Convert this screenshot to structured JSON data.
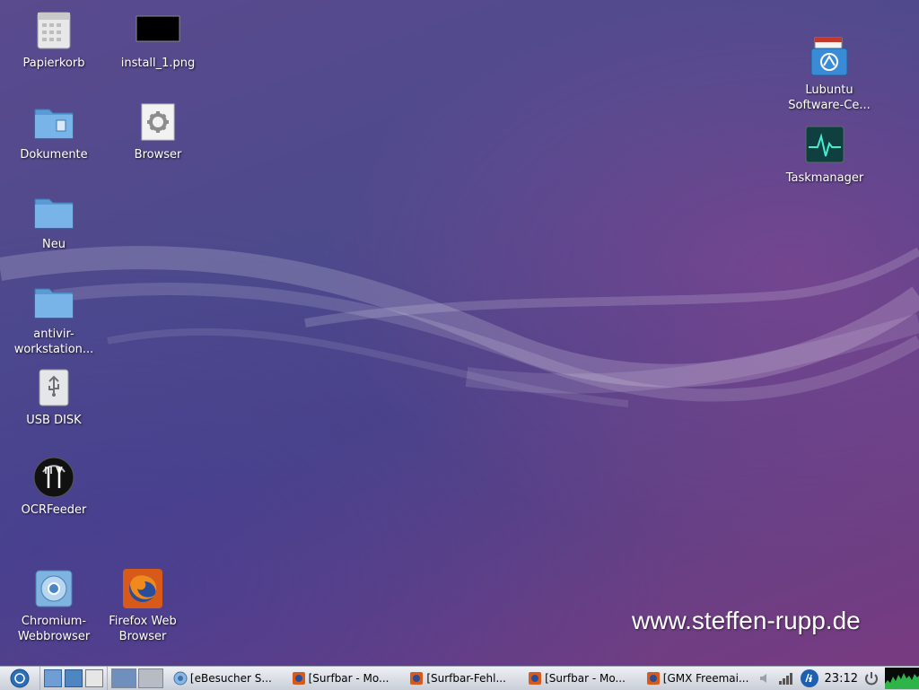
{
  "desktop": {
    "icons_left": [
      {
        "label": "Papierkorb"
      },
      {
        "label": "Dokumente"
      },
      {
        "label": "Neu"
      },
      {
        "label": "antivir-\nworkstation..."
      },
      {
        "label": "USB DISK"
      },
      {
        "label": "OCRFeeder"
      },
      {
        "label": "Chromium-\nWebbrowser"
      }
    ],
    "icons_second": [
      {
        "label": "install_1.png"
      },
      {
        "label": "Browser"
      },
      {
        "label": "Firefox Web\nBrowser"
      }
    ],
    "icons_right": [
      {
        "label": "Lubuntu\nSoftware-Ce..."
      },
      {
        "label": "Taskmanager"
      }
    ],
    "watermark": "www.steffen-rupp.de"
  },
  "taskbar": {
    "tasks": [
      {
        "label": "[eBesucher S..."
      },
      {
        "label": "[Surfbar - Mo..."
      },
      {
        "label": "[Surfbar-Fehl..."
      },
      {
        "label": "[Surfbar - Mo..."
      },
      {
        "label": "[GMX Freemai..."
      }
    ],
    "clock": "23:12"
  }
}
